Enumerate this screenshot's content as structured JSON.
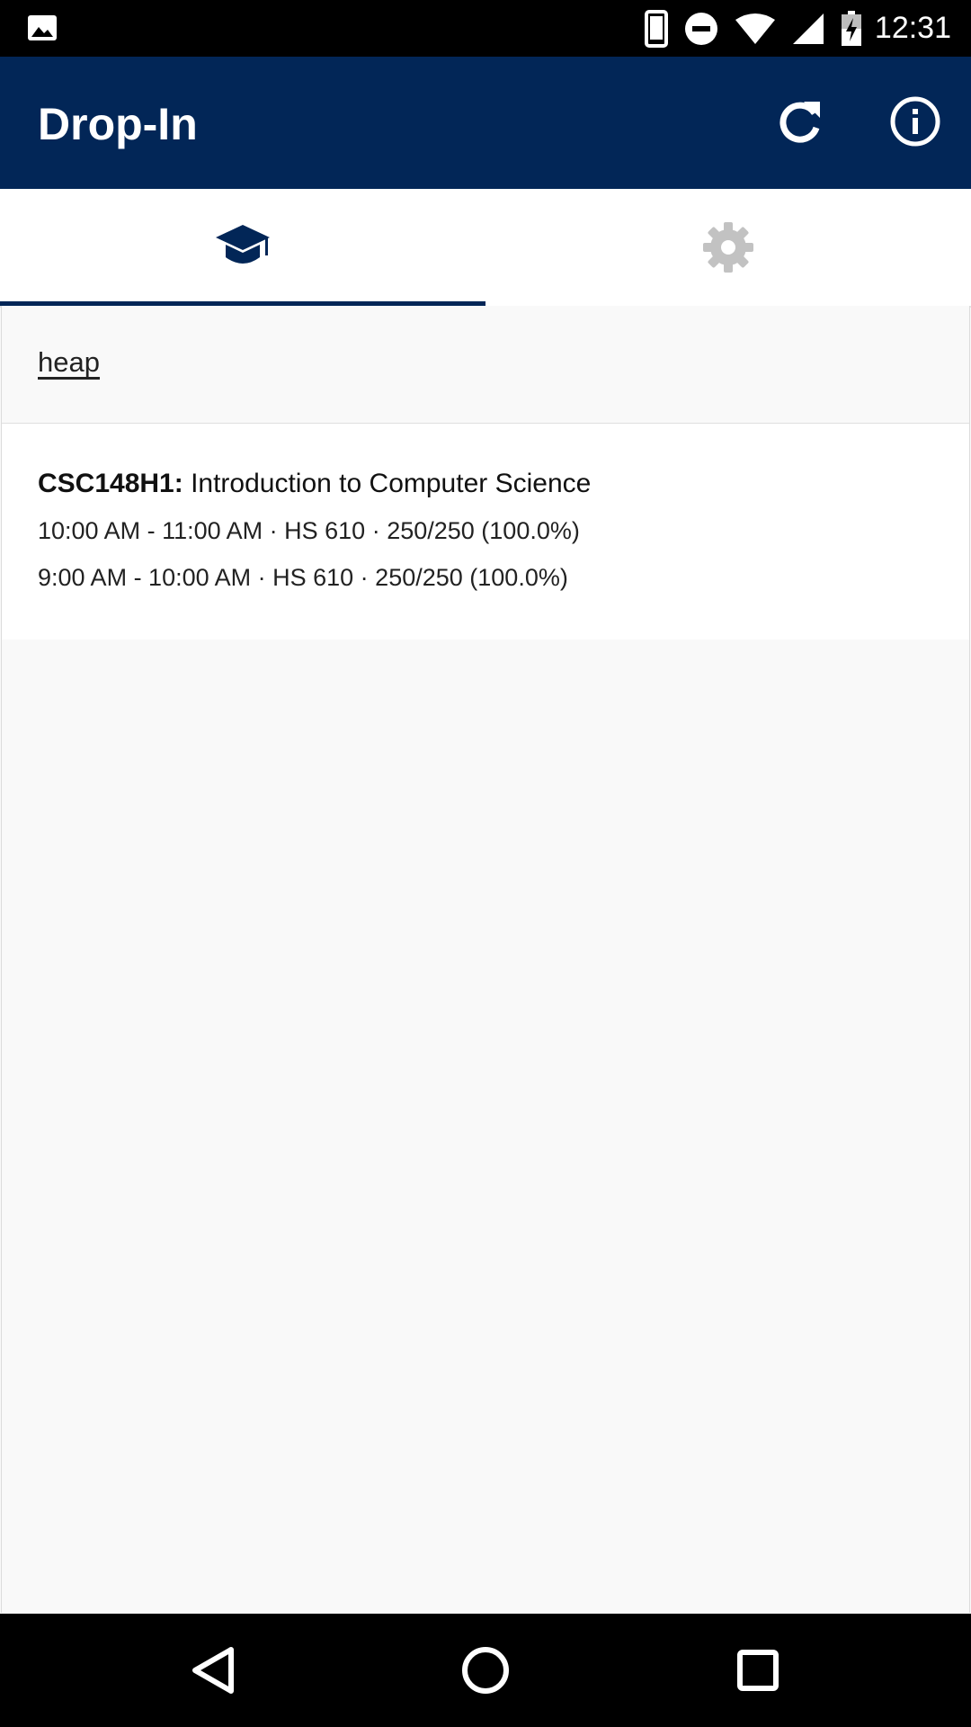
{
  "status_bar": {
    "time": "12:31",
    "icons": [
      "photo-icon",
      "phone-icon",
      "do-not-disturb-icon",
      "wifi-icon",
      "signal-icon",
      "battery-charging-icon"
    ]
  },
  "app_bar": {
    "title": "Drop-In",
    "actions": [
      "refresh-icon",
      "info-icon"
    ],
    "color": "#022657"
  },
  "tabs": [
    {
      "icon": "graduation-cap-icon",
      "selected": true
    },
    {
      "icon": "gear-icon",
      "selected": false
    }
  ],
  "search": {
    "value": "heap"
  },
  "results": [
    {
      "code": "CSC148H1:",
      "name": " Introduction to Computer Science",
      "sessions": [
        "10:00 AM - 11:00 AM · HS 610 · 250/250 (100.0%)",
        "9:00 AM - 10:00 AM · HS 610 · 250/250 (100.0%)"
      ]
    }
  ],
  "nav_bar": {
    "buttons": [
      "back-icon",
      "home-icon",
      "recents-icon"
    ]
  }
}
